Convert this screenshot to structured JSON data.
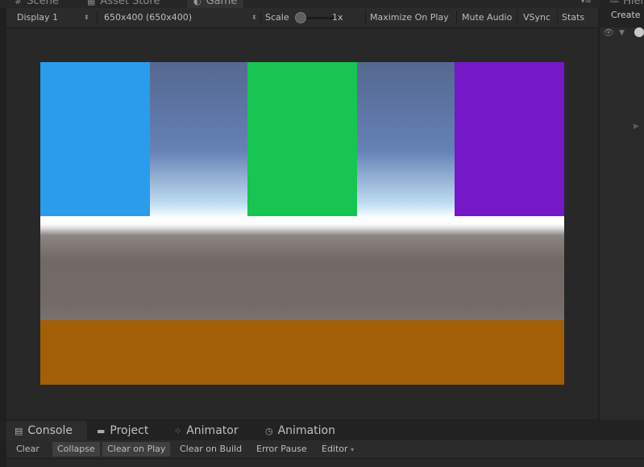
{
  "tabs": {
    "scene": "Scene",
    "asset_store": "Asset Store",
    "game": "Game",
    "hierarchy": "Hierar"
  },
  "toolbar": {
    "display": "Display 1",
    "resolution": "650x400 (650x400)",
    "scale_label": "Scale",
    "scale_value": "1x",
    "maximize_on_play": "Maximize On Play",
    "mute_audio": "Mute Audio",
    "vsync": "VSync",
    "stats": "Stats"
  },
  "hierarchy": {
    "create": "Create"
  },
  "scene": {
    "blocks": [
      {
        "name": "blue-block",
        "color": "#2a9ceb"
      },
      {
        "name": "green-block",
        "color": "#18c452"
      },
      {
        "name": "purple-block",
        "color": "#7418c8"
      },
      {
        "name": "orange-floor",
        "color": "#a35f05"
      }
    ]
  },
  "bottom_tabs": {
    "console": "Console",
    "project": "Project",
    "animator": "Animator",
    "animation": "Animation"
  },
  "console_toolbar": {
    "clear": "Clear",
    "collapse": "Collapse",
    "clear_on_play": "Clear on Play",
    "clear_on_build": "Clear on Build",
    "error_pause": "Error Pause",
    "editor": "Editor"
  }
}
